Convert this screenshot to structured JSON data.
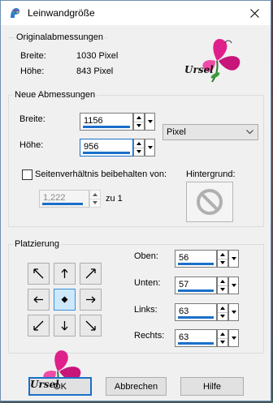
{
  "window": {
    "title": "Leinwandgröße"
  },
  "original": {
    "group_label": "Originalabmessungen",
    "width_label": "Breite:",
    "width_value": "1030 Pixel",
    "height_label": "Höhe:",
    "height_value": "843 Pixel"
  },
  "watermark": {
    "text": "Ursel"
  },
  "new_dims": {
    "group_label": "Neue Abmessungen",
    "width_label": "Breite:",
    "width_value": "1156",
    "height_label": "Höhe:",
    "height_value": "956",
    "unit_selected": "Pixel",
    "aspect_label": "Seitenverhältnis beibehalten von:",
    "aspect_value": "1,222",
    "aspect_suffix": "zu 1",
    "background_label": "Hintergrund:"
  },
  "placement": {
    "group_label": "Platzierung",
    "top_label": "Oben:",
    "top_value": "56",
    "bottom_label": "Unten:",
    "bottom_value": "57",
    "left_label": "Links:",
    "left_value": "63",
    "right_label": "Rechts:",
    "right_value": "63"
  },
  "buttons": {
    "ok": "OK",
    "cancel": "Abbrechen",
    "help": "Hilfe"
  },
  "colors": {
    "accent": "#1a6fc9",
    "selected_anchor": "#cde8fb",
    "flower": "#e0208a"
  }
}
